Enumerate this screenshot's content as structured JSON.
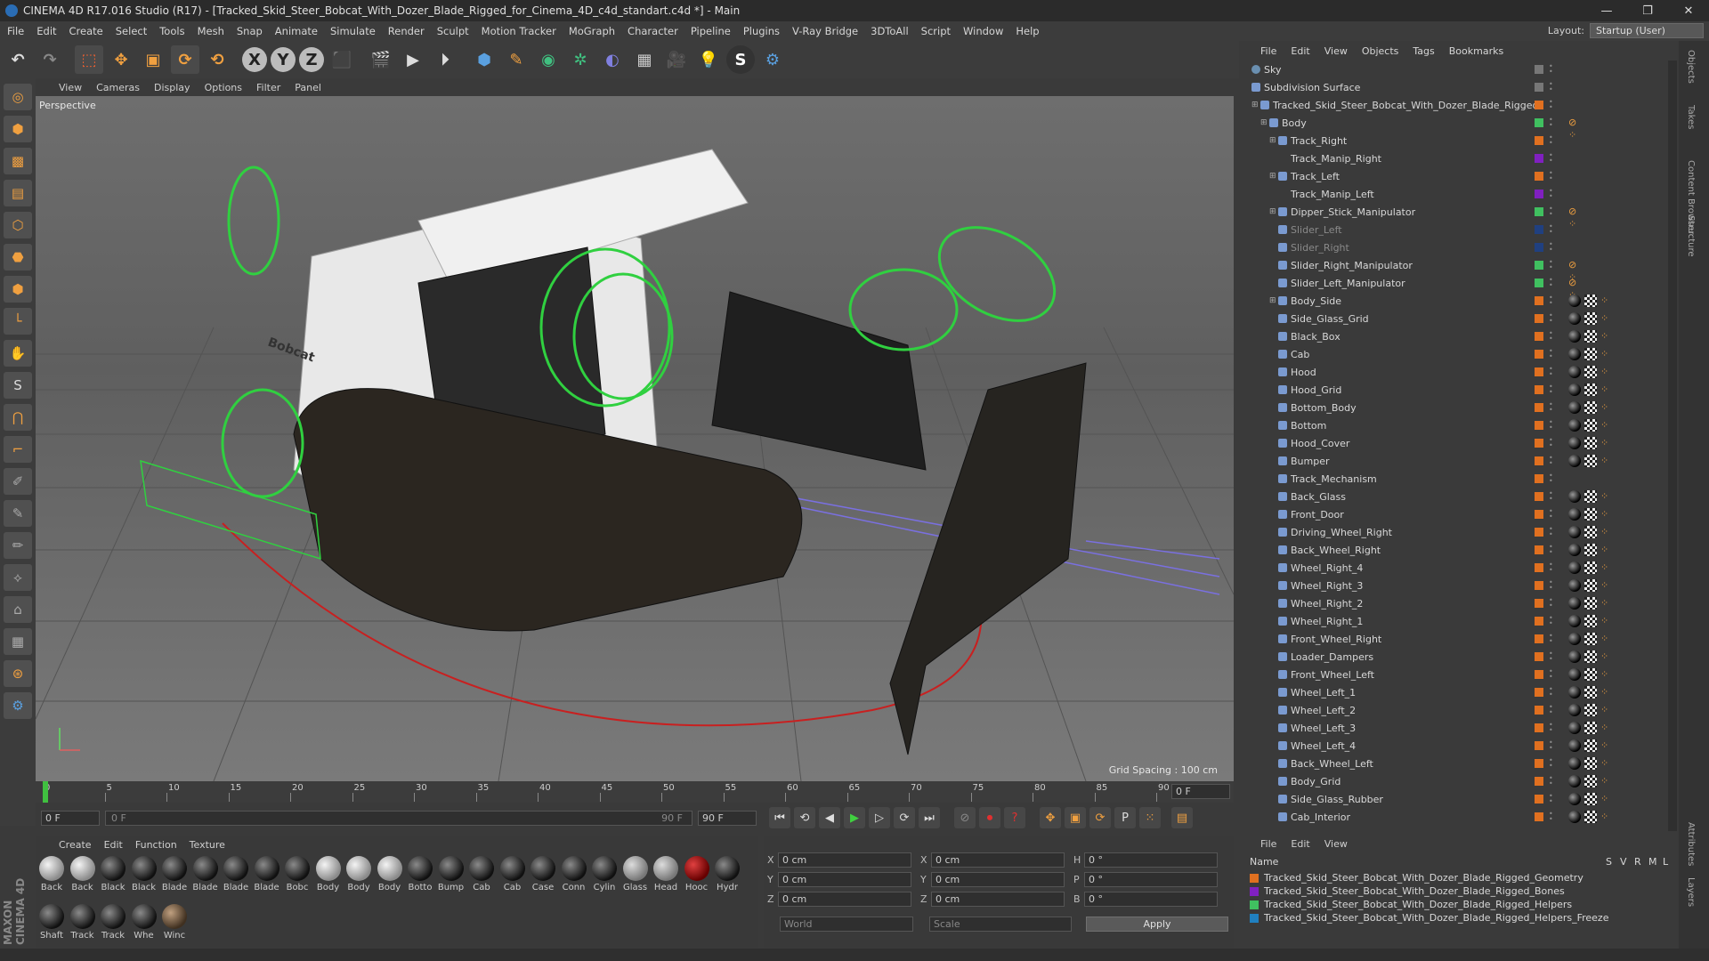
{
  "window": {
    "title": "CINEMA 4D R17.016 Studio (R17) - [Tracked_Skid_Steer_Bobcat_With_Dozer_Blade_Rigged_for_Cinema_4D_c4d_standart.c4d *] - Main",
    "min": "—",
    "max": "❐",
    "close": "✕"
  },
  "menu": [
    "File",
    "Edit",
    "Create",
    "Select",
    "Tools",
    "Mesh",
    "Snap",
    "Animate",
    "Simulate",
    "Render",
    "Sculpt",
    "Motion Tracker",
    "MoGraph",
    "Character",
    "Pipeline",
    "Plugins",
    "V-Ray Bridge",
    "3DToAll",
    "Script",
    "Window",
    "Help"
  ],
  "layout": {
    "label": "Layout:",
    "value": "Startup (User)"
  },
  "toolbar": {
    "undo": "↶",
    "redo": "↷",
    "select": "⬚",
    "move": "✥",
    "scale": "▣",
    "rotate": "⟳",
    "rot2": "⟲",
    "x": "X",
    "y": "Y",
    "z": "Z",
    "coord": "⬛",
    "render1": "🎬",
    "render2": "▶",
    "render3": "⏵",
    "cube": "⬢",
    "pen": "✎",
    "nurbs": "◉",
    "array": "✲",
    "deform": "◐",
    "floor": "▦",
    "camera": "🎥",
    "light": "💡",
    "vray": "S",
    "python": "⚙"
  },
  "viewport": {
    "menu": [
      "View",
      "Cameras",
      "Display",
      "Options",
      "Filter",
      "Panel"
    ],
    "label": "Perspective",
    "grid_spacing": "Grid Spacing : 100 cm",
    "bobcat_text": "Bobcat"
  },
  "timeline": {
    "ticks": [
      "0",
      "5",
      "10",
      "15",
      "20",
      "25",
      "30",
      "35",
      "40",
      "45",
      "50",
      "55",
      "60",
      "65",
      "70",
      "75",
      "80",
      "85",
      "90"
    ],
    "frame_field": "0 F"
  },
  "transport": {
    "start": "0 F",
    "slider_start": "0 F",
    "slider_end": "90 F",
    "end": "90 F"
  },
  "materials": {
    "menu": [
      "Create",
      "Edit",
      "Function",
      "Texture"
    ],
    "items": [
      "Back",
      "Back",
      "Black",
      "Black",
      "Blade",
      "Blade",
      "Blade",
      "Blade",
      "Bobc",
      "Body",
      "Body",
      "Body",
      "Botto",
      "Bump",
      "Cab",
      "Cab",
      "Case",
      "Conn",
      "Cylin",
      "Glass",
      "Head",
      "Hooc",
      "Hydr",
      "Shaft",
      "Track",
      "Track",
      "Whe",
      "Winc"
    ]
  },
  "coords": {
    "rows": [
      {
        "a": "X",
        "av": "0 cm",
        "b": "X",
        "bv": "0 cm",
        "c": "H",
        "cv": "0 °"
      },
      {
        "a": "Y",
        "av": "0 cm",
        "b": "Y",
        "bv": "0 cm",
        "c": "P",
        "cv": "0 °"
      },
      {
        "a": "Z",
        "av": "0 cm",
        "b": "Z",
        "bv": "0 cm",
        "c": "B",
        "cv": "0 °"
      }
    ],
    "mode": "World",
    "scale": "Scale",
    "apply": "Apply"
  },
  "objects": {
    "menu": [
      "File",
      "Edit",
      "View",
      "Objects",
      "Tags",
      "Bookmarks"
    ],
    "rows": [
      {
        "name": "Sky",
        "indent": 0,
        "c": "#777777"
      },
      {
        "name": "Subdivision Surface",
        "indent": 0,
        "c": "#777777"
      },
      {
        "name": "Tracked_Skid_Steer_Bobcat_With_Dozer_Blade_Rigged",
        "indent": 1,
        "c": "#e07020"
      },
      {
        "name": "Body",
        "indent": 2,
        "c": "#40c060"
      },
      {
        "name": "Track_Right",
        "indent": 3,
        "c": "#e07020"
      },
      {
        "name": "Track_Manip_Right",
        "indent": 3,
        "c": "#8020c0"
      },
      {
        "name": "Track_Left",
        "indent": 3,
        "c": "#e07020"
      },
      {
        "name": "Track_Manip_Left",
        "indent": 3,
        "c": "#8020c0"
      },
      {
        "name": "Dipper_Stick_Manipulator",
        "indent": 3,
        "c": "#40c060"
      },
      {
        "name": "Slider_Left",
        "indent": 3,
        "c": "#204080",
        "dim": true
      },
      {
        "name": "Slider_Right",
        "indent": 3,
        "c": "#204080",
        "dim": true
      },
      {
        "name": "Slider_Right_Manipulator",
        "indent": 3,
        "c": "#40c060"
      },
      {
        "name": "Slider_Left_Manipulator",
        "indent": 3,
        "c": "#40c060"
      },
      {
        "name": "Body_Side",
        "indent": 3,
        "c": "#e07020"
      },
      {
        "name": "Side_Glass_Grid",
        "indent": 3,
        "c": "#e07020"
      },
      {
        "name": "Black_Box",
        "indent": 3,
        "c": "#e07020"
      },
      {
        "name": "Cab",
        "indent": 3,
        "c": "#e07020"
      },
      {
        "name": "Hood",
        "indent": 3,
        "c": "#e07020"
      },
      {
        "name": "Hood_Grid",
        "indent": 3,
        "c": "#e07020"
      },
      {
        "name": "Bottom_Body",
        "indent": 3,
        "c": "#e07020"
      },
      {
        "name": "Bottom",
        "indent": 3,
        "c": "#e07020"
      },
      {
        "name": "Hood_Cover",
        "indent": 3,
        "c": "#e07020"
      },
      {
        "name": "Bumper",
        "indent": 3,
        "c": "#e07020"
      },
      {
        "name": "Track_Mechanism",
        "indent": 3,
        "c": "#e07020"
      },
      {
        "name": "Back_Glass",
        "indent": 3,
        "c": "#e07020"
      },
      {
        "name": "Front_Door",
        "indent": 3,
        "c": "#e07020"
      },
      {
        "name": "Driving_Wheel_Right",
        "indent": 3,
        "c": "#e07020"
      },
      {
        "name": "Back_Wheel_Right",
        "indent": 3,
        "c": "#e07020"
      },
      {
        "name": "Wheel_Right_4",
        "indent": 3,
        "c": "#e07020"
      },
      {
        "name": "Wheel_Right_3",
        "indent": 3,
        "c": "#e07020"
      },
      {
        "name": "Wheel_Right_2",
        "indent": 3,
        "c": "#e07020"
      },
      {
        "name": "Wheel_Right_1",
        "indent": 3,
        "c": "#e07020"
      },
      {
        "name": "Front_Wheel_Right",
        "indent": 3,
        "c": "#e07020"
      },
      {
        "name": "Loader_Dampers",
        "indent": 3,
        "c": "#e07020"
      },
      {
        "name": "Front_Wheel_Left",
        "indent": 3,
        "c": "#e07020"
      },
      {
        "name": "Wheel_Left_1",
        "indent": 3,
        "c": "#e07020"
      },
      {
        "name": "Wheel_Left_2",
        "indent": 3,
        "c": "#e07020"
      },
      {
        "name": "Wheel_Left_3",
        "indent": 3,
        "c": "#e07020"
      },
      {
        "name": "Wheel_Left_4",
        "indent": 3,
        "c": "#e07020"
      },
      {
        "name": "Back_Wheel_Left",
        "indent": 3,
        "c": "#e07020"
      },
      {
        "name": "Body_Grid",
        "indent": 3,
        "c": "#e07020"
      },
      {
        "name": "Side_Glass_Rubber",
        "indent": 3,
        "c": "#e07020"
      },
      {
        "name": "Cab_Interior",
        "indent": 3,
        "c": "#e07020"
      }
    ]
  },
  "layers": {
    "menu": [
      "File",
      "Edit",
      "View"
    ],
    "header": {
      "name": "Name",
      "s": "S",
      "v": "V",
      "r": "R",
      "m": "M",
      "l": "L"
    },
    "rows": [
      {
        "name": "Tracked_Skid_Steer_Bobcat_With_Dozer_Blade_Rigged_Geometry",
        "c": "#e07020"
      },
      {
        "name": "Tracked_Skid_Steer_Bobcat_With_Dozer_Blade_Rigged_Bones",
        "c": "#8020c0"
      },
      {
        "name": "Tracked_Skid_Steer_Bobcat_With_Dozer_Blade_Rigged_Helpers",
        "c": "#40c060"
      },
      {
        "name": "Tracked_Skid_Steer_Bobcat_With_Dozer_Blade_Rigged_Helpers_Freeze",
        "c": "#2080c0"
      }
    ]
  },
  "right_strip": [
    "Objects",
    "Takes",
    "Content Browser",
    "Structure",
    "Attributes",
    "Layers"
  ],
  "brand": "MAXON CINEMA 4D"
}
